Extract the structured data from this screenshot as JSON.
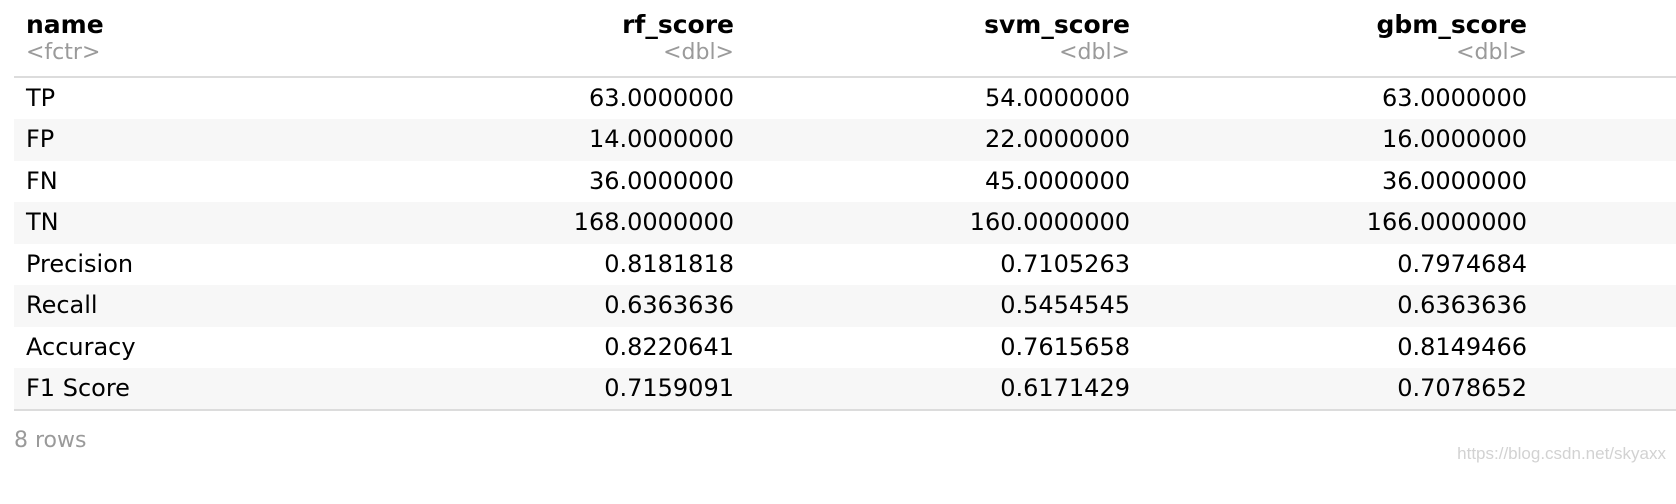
{
  "columns": [
    {
      "name": "name",
      "type": "<fctr>"
    },
    {
      "name": "rf_score",
      "type": "<dbl>"
    },
    {
      "name": "svm_score",
      "type": "<dbl>"
    },
    {
      "name": "gbm_score",
      "type": "<dbl>"
    }
  ],
  "rows": [
    [
      "TP",
      "63.0000000",
      "54.0000000",
      "63.0000000"
    ],
    [
      "FP",
      "14.0000000",
      "22.0000000",
      "16.0000000"
    ],
    [
      "FN",
      "36.0000000",
      "45.0000000",
      "36.0000000"
    ],
    [
      "TN",
      "168.0000000",
      "160.0000000",
      "166.0000000"
    ],
    [
      "Precision",
      "0.8181818",
      "0.7105263",
      "0.7974684"
    ],
    [
      "Recall",
      "0.6363636",
      "0.5454545",
      "0.6363636"
    ],
    [
      "Accuracy",
      "0.8220641",
      "0.7615658",
      "0.8149466"
    ],
    [
      "F1 Score",
      "0.7159091",
      "0.6171429",
      "0.7078652"
    ]
  ],
  "footer": {
    "row_count": "8 rows"
  },
  "watermark": "https://blog.csdn.net/skyaxx",
  "colors": {
    "header_border": "#dcdcdc",
    "stripe": "#f7f7f7",
    "muted_text": "#9a9a9a"
  }
}
